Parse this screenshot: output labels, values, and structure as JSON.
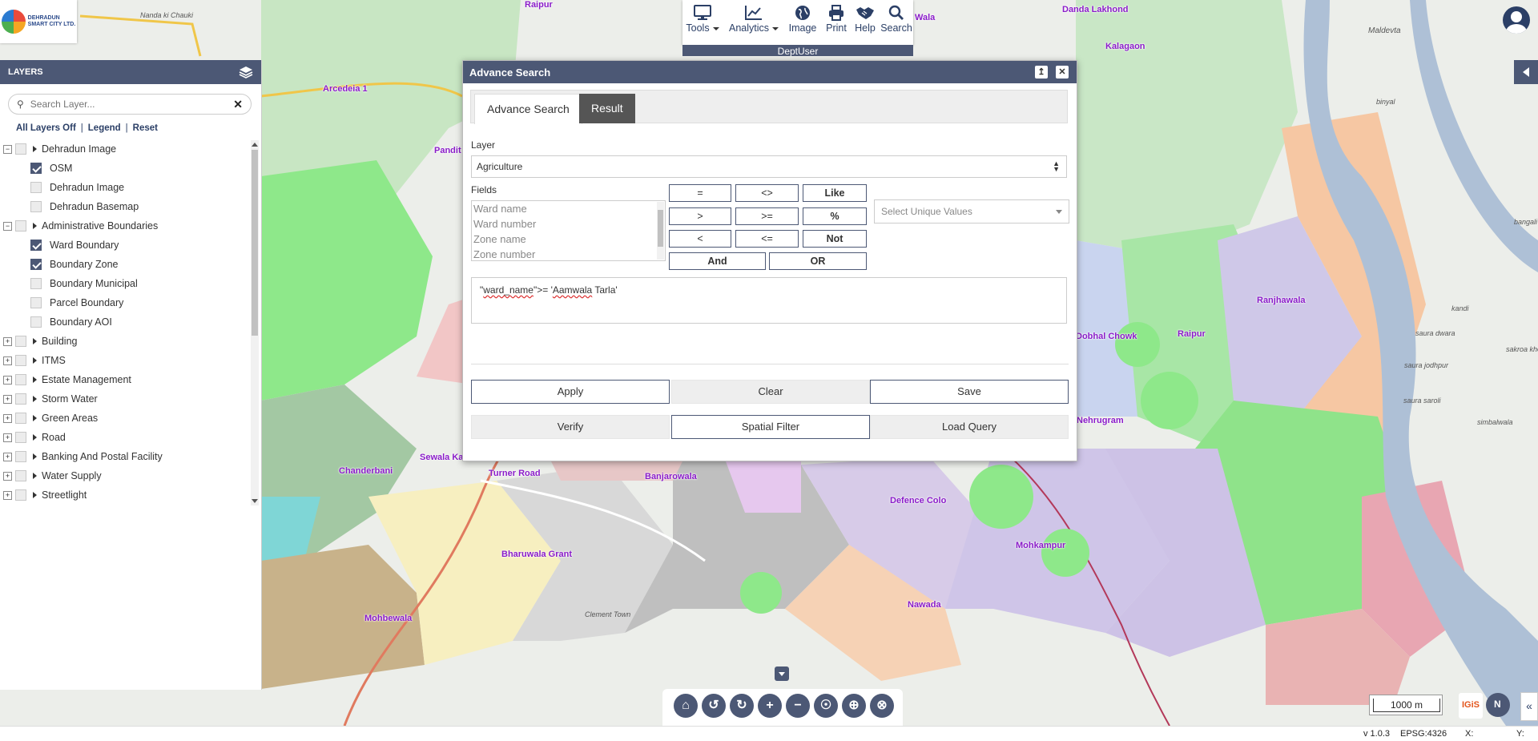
{
  "logo": {
    "name_line1": "DEHRADUN",
    "name_line2": "SMART CITY LTD."
  },
  "layers_panel": {
    "title": "LAYERS",
    "search_placeholder": "Search Layer...",
    "links": {
      "all_off": "All Layers Off",
      "legend": "Legend",
      "reset": "Reset"
    },
    "tree": [
      {
        "label": "Dehradun Image",
        "type": "group",
        "expanded": true
      },
      {
        "label": "OSM",
        "type": "child",
        "checked": true
      },
      {
        "label": "Dehradun Image",
        "type": "child",
        "checked": false
      },
      {
        "label": "Dehradun Basemap",
        "type": "child",
        "checked": false
      },
      {
        "label": "Administrative Boundaries",
        "type": "group",
        "expanded": true
      },
      {
        "label": "Ward Boundary",
        "type": "child",
        "checked": true
      },
      {
        "label": "Boundary Zone",
        "type": "child",
        "checked": true
      },
      {
        "label": "Boundary Municipal",
        "type": "child",
        "checked": false
      },
      {
        "label": "Parcel Boundary",
        "type": "child",
        "checked": false
      },
      {
        "label": "Boundary AOI",
        "type": "child",
        "checked": false
      },
      {
        "label": "Building",
        "type": "group",
        "expanded": false
      },
      {
        "label": "ITMS",
        "type": "group",
        "expanded": false
      },
      {
        "label": "Estate Management",
        "type": "group",
        "expanded": false
      },
      {
        "label": "Storm Water",
        "type": "group",
        "expanded": false
      },
      {
        "label": "Green Areas",
        "type": "group",
        "expanded": false
      },
      {
        "label": "Road",
        "type": "group",
        "expanded": false
      },
      {
        "label": "Banking And Postal Facility",
        "type": "group",
        "expanded": false
      },
      {
        "label": "Water Supply",
        "type": "group",
        "expanded": false
      },
      {
        "label": "Streetlight",
        "type": "group",
        "expanded": false
      }
    ]
  },
  "toolbar": {
    "tools": [
      {
        "label": "Tools",
        "icon": "monitor-icon",
        "dropdown": true
      },
      {
        "label": "Analytics",
        "icon": "chart-icon",
        "dropdown": true
      },
      {
        "label": "Image",
        "icon": "globe-icon",
        "dropdown": false
      },
      {
        "label": "Print",
        "icon": "printer-icon",
        "dropdown": false
      },
      {
        "label": "Help",
        "icon": "handshake-icon",
        "dropdown": false
      },
      {
        "label": "Search",
        "icon": "search-icon",
        "dropdown": false
      }
    ],
    "user_label": "DeptUser"
  },
  "dialog": {
    "title": "Advance Search",
    "tabs": [
      "Advance Search",
      "Result"
    ],
    "layer_label": "Layer",
    "layer_value": "Agriculture",
    "fields_label": "Fields",
    "fields": [
      "Ward name",
      "Ward number",
      "Zone name",
      "Zone number"
    ],
    "operators": [
      "=",
      "<>",
      "Like",
      ">",
      ">=",
      "%",
      "<",
      "<=",
      "Not",
      "And",
      "OR"
    ],
    "unique_placeholder": "Select Unique Values",
    "query_parts": [
      "\"",
      "ward_name",
      "\">= '",
      "Aamwala",
      " Tarla'"
    ],
    "actions": [
      "Apply",
      "Clear",
      "Save",
      "Verify",
      "Spatial Filter",
      "Load Query"
    ]
  },
  "map": {
    "places": [
      "Raipur",
      "Danda Lakhond",
      "Arcedeia 1",
      "Pandit",
      "Chanderbani",
      "Turner Road",
      "Banjarowala",
      "Sewala Ka",
      "Bharuwala Grant",
      "Mohbewala",
      "Defence Colo",
      "Mohkampur",
      "Nawada",
      "Nehrugram",
      "Dobhal Chowk",
      "Ranjhawala",
      "Raipur",
      "Kalagaon",
      "Wala"
    ],
    "grey_labels": [
      "Maldevta",
      "kandi",
      "saura dwara",
      "saura jodhpur",
      "saura saroli",
      "simbalwala",
      "binyal",
      "sakroa kholo",
      "bangali",
      "Nanda ki Chauki",
      "Clement Town"
    ]
  },
  "footer": {
    "scale": "1000 m",
    "igis": "IGiS",
    "version": "v 1.0.3",
    "epsg": "EPSG:4326",
    "x_label": "X:",
    "y_label": "Y:"
  }
}
